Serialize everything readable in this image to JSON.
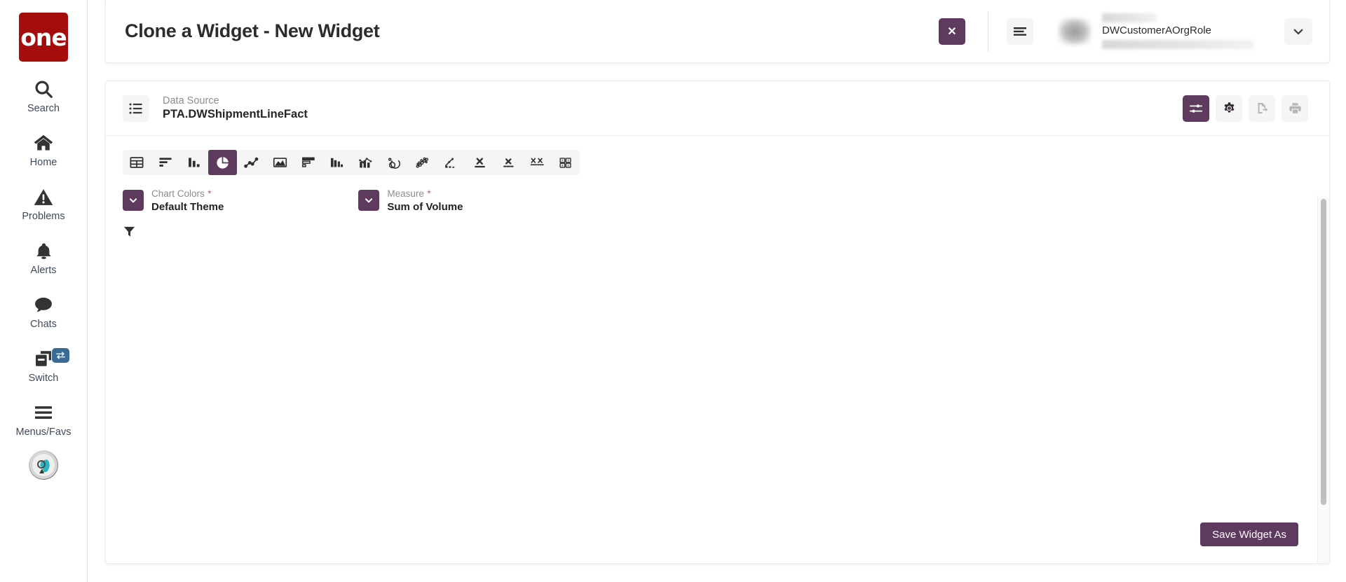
{
  "brand": {
    "logo_text": "one",
    "logo_color": "#a50d0d"
  },
  "theme": {
    "accent": "#5e3a5e",
    "badge_blue": "#3a6a96",
    "required_red": "#e0555a"
  },
  "sidebar": {
    "items": [
      {
        "label": "Search",
        "icon": "search-icon"
      },
      {
        "label": "Home",
        "icon": "home-icon"
      },
      {
        "label": "Problems",
        "icon": "warning-triangle-icon"
      },
      {
        "label": "Alerts",
        "icon": "bell-icon"
      },
      {
        "label": "Chats",
        "icon": "chat-bubble-icon"
      },
      {
        "label": "Switch",
        "icon": "windows-stack-icon",
        "badge_icon": "swap-arrows-icon"
      },
      {
        "label": "Menus/Favs",
        "icon": "hamburger-icon"
      }
    ],
    "avatar": "user-avatar-image"
  },
  "header": {
    "title": "Clone a Widget - New Widget",
    "close_label": "✕",
    "menu_icon": "hamburger-menu-icon",
    "user_role": "DWCustomerAOrgRole",
    "dropdown_icon": "chevron-down-icon"
  },
  "datasource": {
    "icon": "list-icon",
    "label": "Data Source",
    "value": "PTA.DWShipmentLineFact",
    "actions": [
      {
        "name": "sliders-icon",
        "title": "Configure",
        "state": "active"
      },
      {
        "name": "gear-icon",
        "title": "Settings",
        "state": "normal"
      },
      {
        "name": "export-icon",
        "title": "Export",
        "state": "disabled"
      },
      {
        "name": "print-icon",
        "title": "Print",
        "state": "disabled"
      }
    ]
  },
  "chart_types": [
    {
      "name": "table-icon",
      "title": "Table",
      "active": false
    },
    {
      "name": "horizontal-bar-icon",
      "title": "Horizontal Bar",
      "active": false
    },
    {
      "name": "column-chart-icon",
      "title": "Column Chart",
      "active": false
    },
    {
      "name": "pie-chart-icon",
      "title": "Pie Chart",
      "active": true
    },
    {
      "name": "line-chart-icon",
      "title": "Line Chart",
      "active": false
    },
    {
      "name": "area-chart-icon",
      "title": "Area Chart",
      "active": false
    },
    {
      "name": "stacked-bar-icon",
      "title": "Stacked Bar",
      "active": false
    },
    {
      "name": "grouped-column-icon",
      "title": "Grouped Column",
      "active": false
    },
    {
      "name": "combo-chart-icon",
      "title": "Combo Chart",
      "active": false
    },
    {
      "name": "donut-gauge-icon",
      "title": "Donut Gauge",
      "active": false
    },
    {
      "name": "bubble-chart-icon",
      "title": "Bubble Chart",
      "active": false
    },
    {
      "name": "pareto-chart-icon",
      "title": "Pareto Chart",
      "active": false
    },
    {
      "name": "single-value-icon",
      "title": "Single Value",
      "active": false
    },
    {
      "name": "value-with-trend-icon",
      "title": "Value With Trend",
      "active": false
    },
    {
      "name": "multi-value-icon",
      "title": "Multi Value",
      "active": false
    },
    {
      "name": "value-grid-icon",
      "title": "Value Grid",
      "active": false
    }
  ],
  "fields": {
    "chart_colors": {
      "label": "Chart Colors",
      "required": "*",
      "value": "Default Theme"
    },
    "measure": {
      "label": "Measure",
      "required": "*",
      "value": "Sum of Volume"
    },
    "filter_icon": "filter-funnel-icon"
  },
  "footer": {
    "save_label": "Save Widget As"
  }
}
